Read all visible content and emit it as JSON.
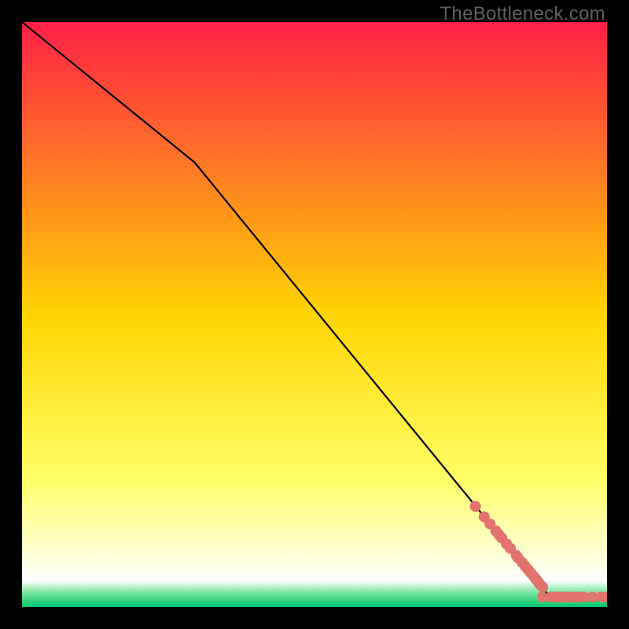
{
  "watermark": "TheBottleneck.com",
  "chart_data": {
    "type": "line",
    "title": "",
    "xlabel": "",
    "ylabel": "",
    "xlim": [
      0,
      1
    ],
    "ylim": [
      0,
      1
    ],
    "background_gradient": {
      "stops": [
        {
          "t": 0.0,
          "color": "#ff1f47"
        },
        {
          "t": 0.5,
          "color": "#ffd400"
        },
        {
          "t": 0.78,
          "color": "#ffff66"
        },
        {
          "t": 0.9,
          "color": "#ffffcc"
        },
        {
          "t": 0.955,
          "color": "#ffffff"
        },
        {
          "t": 0.975,
          "color": "#7be6a0"
        },
        {
          "t": 1.0,
          "color": "#00c56a"
        }
      ]
    },
    "series": [
      {
        "name": "curve",
        "type": "line",
        "color": "#000000",
        "x": [
          0.0,
          0.295,
          0.9,
          1.0
        ],
        "y": [
          1.0,
          0.76,
          0.02,
          0.02
        ]
      },
      {
        "name": "points-upper-cluster",
        "type": "scatter",
        "color": "#e2736e",
        "radius": 7,
        "x": [
          0.775,
          0.79,
          0.8,
          0.81,
          0.815,
          0.82,
          0.828,
          0.835,
          0.845,
          0.848,
          0.855,
          0.86,
          0.865,
          0.87,
          0.875,
          0.878,
          0.88,
          0.883,
          0.886,
          0.888,
          0.89
        ],
        "y": [
          0.172,
          0.154,
          0.142,
          0.13,
          0.124,
          0.118,
          0.108,
          0.1,
          0.088,
          0.084,
          0.076,
          0.07,
          0.064,
          0.058,
          0.052,
          0.048,
          0.046,
          0.042,
          0.038,
          0.036,
          0.034
        ]
      },
      {
        "name": "points-bottom-cluster",
        "type": "scatter",
        "color": "#e2736e",
        "radius": 7,
        "x": [
          0.89,
          0.905,
          0.912,
          0.918,
          0.926,
          0.933,
          0.94,
          0.95,
          0.96,
          0.975,
          0.99,
          1.0
        ],
        "y": [
          0.017,
          0.017,
          0.017,
          0.017,
          0.017,
          0.017,
          0.017,
          0.017,
          0.017,
          0.017,
          0.017,
          0.017
        ]
      }
    ]
  }
}
